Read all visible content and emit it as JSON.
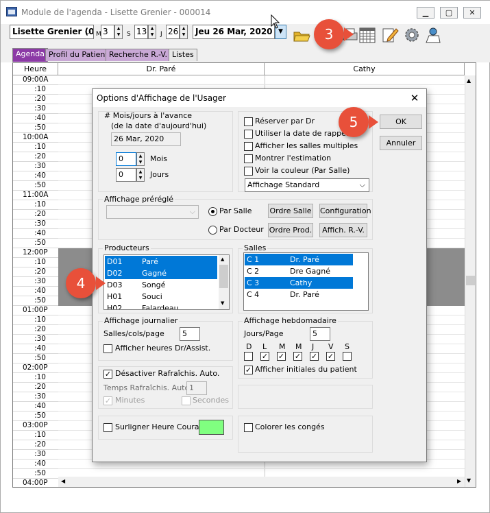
{
  "window": {
    "title": "Module de l'agenda - Lisette Grenier - 000014"
  },
  "toolbar": {
    "provider": "Lisette Grenier (0",
    "m_label": "M",
    "m_value": "3",
    "s_label": "S",
    "s_value": "13",
    "j_label": "J",
    "j_value": "26",
    "date": "Jeu  26 Mar, 2020"
  },
  "tabs": [
    "Agenda",
    "Profil du Patient",
    "Recherche R.-V.",
    "Listes"
  ],
  "grid": {
    "heure_header": "Heure",
    "columns": [
      "Dr. Paré",
      "Cathy"
    ],
    "times": [
      "09:00A",
      ":10",
      ":20",
      ":30",
      ":40",
      ":50",
      "10:00A",
      ":10",
      ":20",
      ":30",
      ":40",
      ":50",
      "11:00A",
      ":10",
      ":20",
      ":30",
      ":40",
      ":50",
      "12:00P",
      ":10",
      ":20",
      ":30",
      ":40",
      ":50",
      "01:00P",
      ":10",
      ":20",
      ":30",
      ":40",
      ":50",
      "02:00P",
      ":10",
      ":20",
      ":30",
      ":40",
      ":50",
      "03:00P",
      ":10",
      ":20",
      ":30",
      ":40",
      ":50",
      "04:00P"
    ]
  },
  "dialog": {
    "title": "Options d'Affichage de l'Usager",
    "advance_label": "# Mois/jours à l'avance",
    "advance_sub": "(de la date d'aujourd'hui)",
    "advance_date": "26 Mar, 2020",
    "mois_value": "0",
    "mois_label": "Mois",
    "jours_value": "0",
    "jours_label": "Jours",
    "options": [
      {
        "label": "Réserver par Dr",
        "checked": false
      },
      {
        "label": "Utiliser la date de rappel",
        "checked": false
      },
      {
        "label": "Afficher les salles multiples",
        "checked": false
      },
      {
        "label": "Montrer l'estimation",
        "checked": false
      },
      {
        "label": "Voir la couleur (Par Salle)",
        "checked": false
      }
    ],
    "display_select": "Affichage Standard",
    "ok": "OK",
    "cancel": "Annuler",
    "preset_label": "Affichage préréglé",
    "preset_value": "",
    "par_salle": "Par Salle",
    "par_docteur": "Par Docteur",
    "ordre_salle": "Ordre Salle",
    "configuration": "Configuration",
    "ordre_prod": "Ordre Prod.",
    "affich_rv": "Affich. R.-V.",
    "producteurs_label": "Producteurs",
    "producteurs": [
      {
        "code": "D01",
        "name": "Paré",
        "selected": true
      },
      {
        "code": "D02",
        "name": "Gagné",
        "selected": true
      },
      {
        "code": "D03",
        "name": "Songé",
        "selected": false
      },
      {
        "code": "H01",
        "name": "Souci",
        "selected": false
      },
      {
        "code": "H02",
        "name": "Falardeau",
        "selected": false
      }
    ],
    "salles_label": "Salles",
    "salles": [
      {
        "code": "C  1",
        "name": "Dr. Paré",
        "selected": true
      },
      {
        "code": "C  2",
        "name": "Dre Gagné",
        "selected": false
      },
      {
        "code": "C  3",
        "name": "Cathy",
        "selected": true
      },
      {
        "code": "C  4",
        "name": "Dr. Paré",
        "selected": false
      }
    ],
    "journalier_label": "Affichage journalier",
    "salles_cols_label": "Salles/cols/page",
    "salles_cols_value": "5",
    "afficher_heures": "Afficher heures Dr/Assist.",
    "hebdo_label": "Affichage hebdomadaire",
    "jours_page_label": "Jours/Page",
    "jours_page_value": "5",
    "days": [
      {
        "letter": "D",
        "checked": false
      },
      {
        "letter": "L",
        "checked": true
      },
      {
        "letter": "M",
        "checked": true
      },
      {
        "letter": "M",
        "checked": true
      },
      {
        "letter": "J",
        "checked": true
      },
      {
        "letter": "V",
        "checked": true
      },
      {
        "letter": "S",
        "checked": false
      }
    ],
    "afficher_initiales": "Afficher initiales du patient",
    "desactiver": "Désactiver Rafraîchis. Auto.",
    "temps_label": "Temps Rafraîchis. Auto.",
    "temps_value": "1",
    "minutes": "Minutes",
    "secondes": "Secondes",
    "surligner": "Surligner Heure Courante",
    "highlight_color": "#80ff80",
    "colorer": "Colorer les congés"
  },
  "callouts": {
    "c3": "3",
    "c4": "4",
    "c5": "5"
  },
  "colors": {
    "tab_active": "#8c3aa6",
    "selection": "#0078d7",
    "callout": "#e8503a"
  }
}
